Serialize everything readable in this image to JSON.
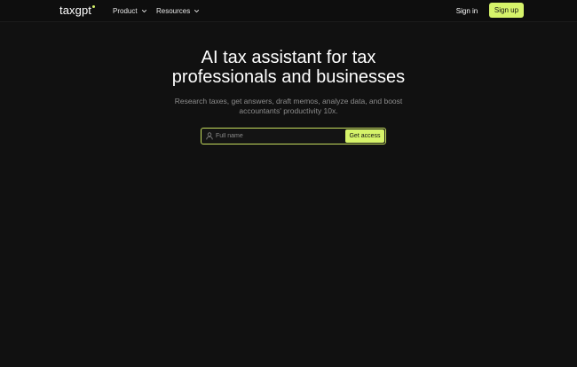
{
  "header": {
    "logo": "taxgpt",
    "nav": [
      {
        "label": "Product",
        "icon": "chevron-down-icon"
      },
      {
        "label": "Resources",
        "icon": "chevron-down-icon"
      }
    ],
    "signin_label": "Sign in",
    "signup_label": "Sign up"
  },
  "hero": {
    "title_line1": "AI tax assistant for tax",
    "title_line2": "professionals and businesses",
    "subtitle_line1": "Research taxes, get answers, draft memos, analyze data, and boost",
    "subtitle_line2": "accountants' productivity 10x."
  },
  "form": {
    "placeholder": "Full name",
    "value": "",
    "button_label": "Get access",
    "icon": "user-icon"
  },
  "colors": {
    "background": "#111111",
    "accent": "#d6f36a",
    "text": "#ffffff",
    "muted_text": "#8c8c8c"
  }
}
